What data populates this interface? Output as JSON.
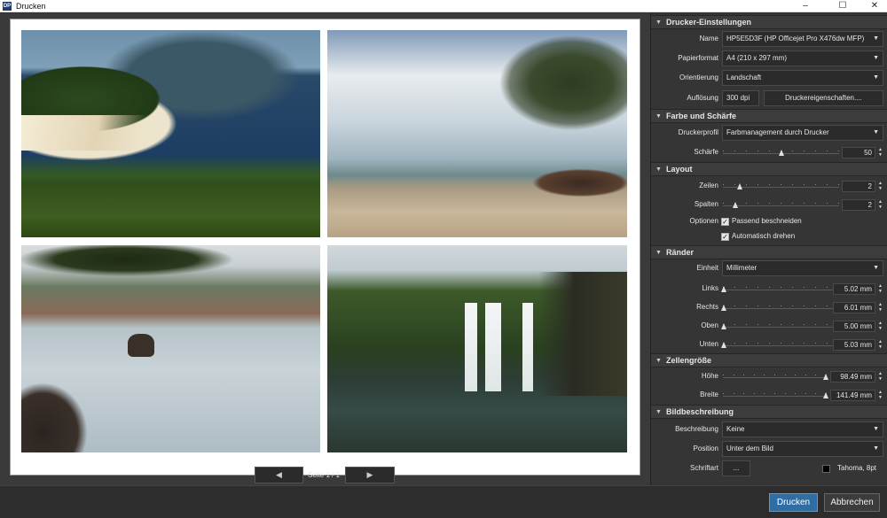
{
  "window": {
    "app_icon": "DP",
    "title": "Drucken",
    "minimize_icon": "minimize-icon",
    "maximize_icon": "maximize-icon",
    "close_icon": "close-icon"
  },
  "preview": {
    "pager": {
      "prev": "◀",
      "label": "Seite 1 / 1",
      "next": "▶"
    }
  },
  "printer": {
    "header": "Drucker-Einstellungen",
    "name_label": "Name",
    "name_value": "HP5E5D3F (HP Officejet Pro X476dw MFP)",
    "paper_label": "Papierformat",
    "paper_value": "A4 (210 x 297 mm)",
    "orientation_label": "Orientierung",
    "orientation_value": "Landschaft",
    "resolution_label": "Auflösung",
    "resolution_value": "300 dpi",
    "properties_button": "Druckereigenschaften...."
  },
  "color": {
    "header": "Farbe und Schärfe",
    "profile_label": "Druckerprofil",
    "profile_value": "Farbmanagement durch Drucker",
    "sharpness_label": "Schärfe",
    "sharpness_value": "50",
    "sharpness_fraction": 0.5
  },
  "layout": {
    "header": "Layout",
    "rows_label": "Zeilen",
    "rows_value": "2",
    "rows_fraction": 0.14,
    "cols_label": "Spalten",
    "cols_value": "2",
    "cols_fraction": 0.1,
    "options_label": "Optionen",
    "fit_label": "Passend beschneiden",
    "autorotate_label": "Automatisch drehen",
    "checkmark": "✓"
  },
  "margins": {
    "header": "Ränder",
    "unit_label": "Einheit",
    "unit_value": "Millimeter",
    "left_label": "Links",
    "left_value": "5.02 mm",
    "right_label": "Rechts",
    "right_value": "6.01 mm",
    "top_label": "Oben",
    "top_value": "5.00 mm",
    "bottom_label": "Unten",
    "bottom_value": "5.03 mm"
  },
  "cellsize": {
    "header": "Zellengröße",
    "height_label": "Höhe",
    "height_value": "98.49 mm",
    "width_label": "Breite",
    "width_value": "141.49 mm"
  },
  "caption": {
    "header": "Bildbeschreibung",
    "desc_label": "Beschreibung",
    "desc_value": "Keine",
    "position_label": "Position",
    "position_value": "Unter dem Bild",
    "font_label": "Schriftart",
    "font_button": "...",
    "font_color": "#000000",
    "font_value": "Tahoma, 8pt"
  },
  "footer": {
    "print_button": "Drucken",
    "cancel_button": "Abbrechen"
  },
  "colors": {
    "accent": "#2f6ea5",
    "panel_bg": "#353535"
  }
}
